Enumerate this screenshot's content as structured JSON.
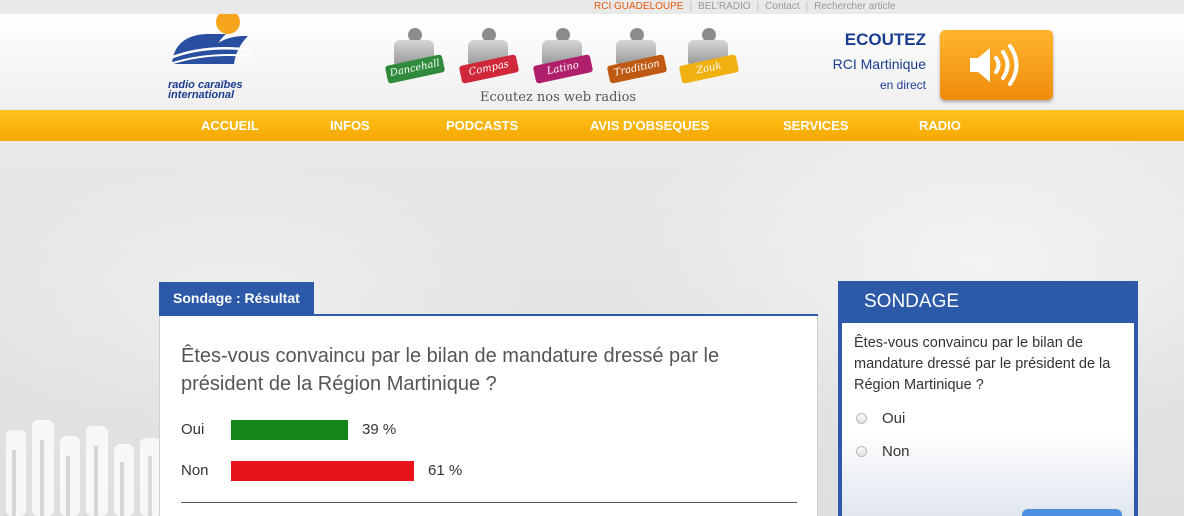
{
  "top_links": [
    {
      "label": "RCI GUADELOUPE",
      "active": true
    },
    {
      "label": "BEL'RADIO",
      "active": false
    },
    {
      "label": "Contact",
      "active": false
    },
    {
      "label": "Rechercher article",
      "active": false
    }
  ],
  "logo": {
    "line1": "radio caraïbes",
    "line2": "international"
  },
  "web_radios": {
    "caption": "Ecoutez nos web radios",
    "stations": [
      {
        "label": "Dancehall",
        "color": "#2f8a3c"
      },
      {
        "label": "Compas",
        "color": "#d0283a"
      },
      {
        "label": "Latino",
        "color": "#b01f6b"
      },
      {
        "label": "Tradition",
        "color": "#c05a12"
      },
      {
        "label": "Zouk",
        "color": "#f0b010"
      }
    ]
  },
  "listen": {
    "title": "ECOUTEZ",
    "station": "RCI Martinique",
    "status": "en direct",
    "icon": "speaker-icon"
  },
  "nav": [
    "ACCUEIL",
    "INFOS",
    "PODCASTS",
    "AVIS D'OBSEQUES",
    "SERVICES",
    "RADIO"
  ],
  "result": {
    "tab": "Sondage : Résultat",
    "question": "Êtes-vous convaincu par le bilan de mandature dressé par le président de la Région Martinique ?",
    "rows": [
      {
        "label": "Oui",
        "percent": 39,
        "percent_label": "39 %",
        "color": "#13851a"
      },
      {
        "label": "Non",
        "percent": 61,
        "percent_label": "61 %",
        "color": "#e8141b"
      }
    ]
  },
  "poll": {
    "title": "SONDAGE",
    "question": "Êtes-vous convaincu par le bilan de mandature dressé par le président de la Région Martinique ?",
    "options": [
      "Oui",
      "Non"
    ]
  },
  "colors": {
    "brand_blue": "#2c5aa8",
    "nav_orange": "#f6a800",
    "accent_orange": "#e55a0c"
  }
}
